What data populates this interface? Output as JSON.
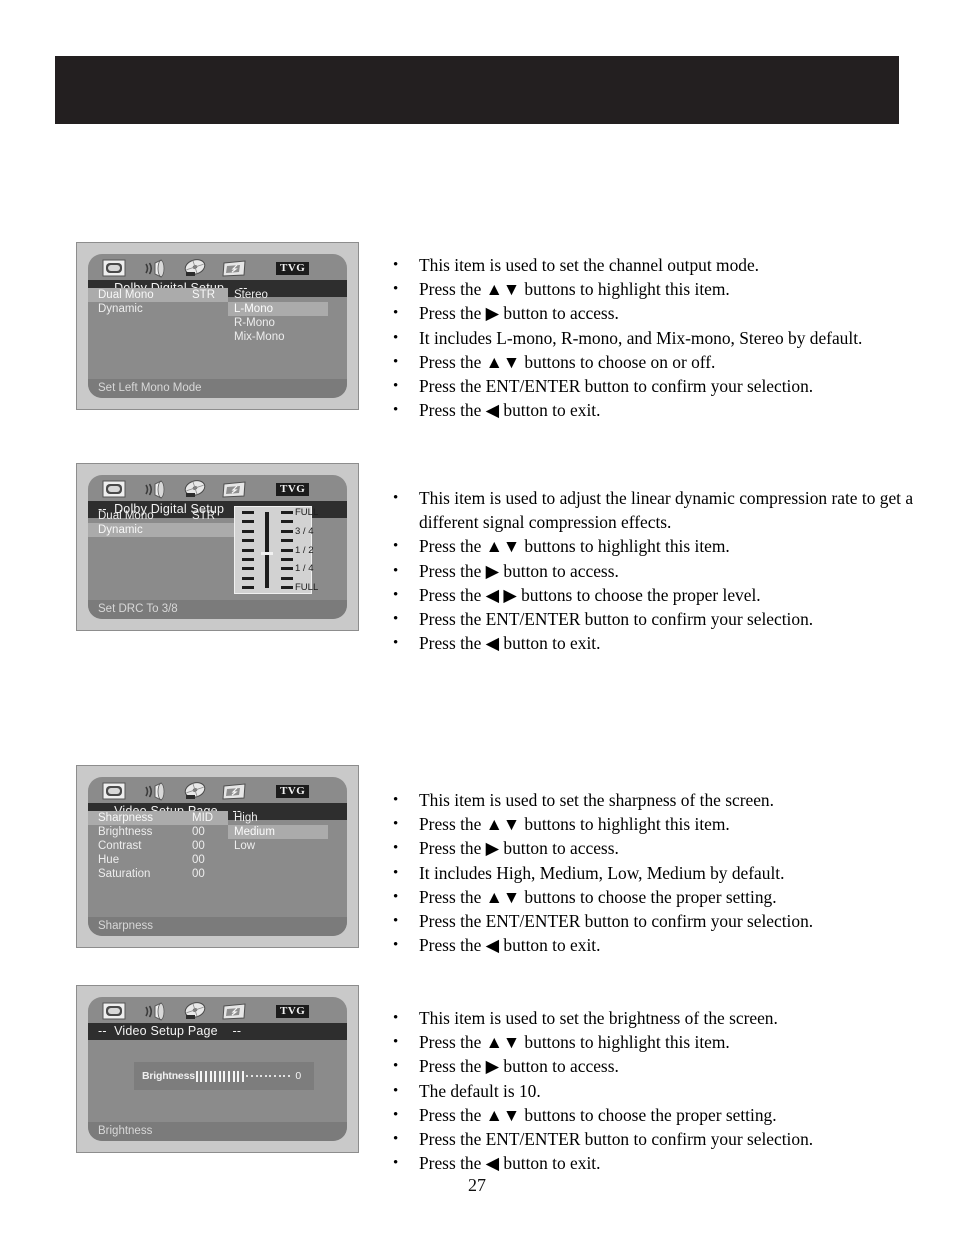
{
  "page": {
    "number": "27",
    "header_band_color": "#231f20"
  },
  "icons": [
    "tv-picture-icon",
    "speaker-audio-icon",
    "disc-setup-icon",
    "display-preference-icon"
  ],
  "tvg_badge": "TVG",
  "figures": [
    {
      "id": "dual-mono",
      "title": "--  Dolby Digital Setup    --",
      "rows": [
        {
          "label": "Dual Mono",
          "value": "STR",
          "selected": true
        },
        {
          "label": "Dynamic",
          "value": "",
          "selected": false
        }
      ],
      "options": [
        "Stereo",
        "L-Mono",
        "R-Mono",
        "Mix-Mono"
      ],
      "selected_option": "L-Mono",
      "hint": "Set Left Mono Mode"
    },
    {
      "id": "dynamic-drc",
      "title": "--  Dolby Digital Setup    --",
      "rows": [
        {
          "label": "Dual Mono",
          "value": "STR",
          "selected": false
        },
        {
          "label": "Dynamic",
          "value": "",
          "selected": true
        }
      ],
      "options": [],
      "selected_option": "",
      "hint": "Set DRC To 3/8",
      "drc": {
        "labels": [
          "FULL",
          "3 / 4",
          "1 / 2",
          "1 / 4",
          "FULL"
        ],
        "tick_rows": 9,
        "knob_position": "3/8"
      }
    },
    {
      "id": "sharpness",
      "title": "--  Video Setup Page    --",
      "rows": [
        {
          "label": "Sharpness",
          "value": "MID",
          "selected": true
        },
        {
          "label": "Brightness",
          "value": "00",
          "selected": false
        },
        {
          "label": "Contrast",
          "value": "00",
          "selected": false
        },
        {
          "label": "Hue",
          "value": "00",
          "selected": false
        },
        {
          "label": "Saturation",
          "value": "00",
          "selected": false
        }
      ],
      "options": [
        "High",
        "Medium",
        "Low"
      ],
      "selected_option": "Medium",
      "hint": "Sharpness"
    },
    {
      "id": "brightness",
      "title": "--  Video Setup Page    --",
      "rows": [],
      "options": [],
      "selected_option": "",
      "hint": "Brightness",
      "brightness_bar": {
        "label": "Brightness",
        "filled": 11,
        "empty": 10,
        "value": "0"
      }
    }
  ],
  "notes": [
    {
      "id": "dual-mono-notes",
      "items": [
        "This item is used to set the channel output mode.",
        "Press the ▲▼ buttons to highlight this item.",
        "Press the ▶ button to access.",
        "It includes L-mono, R-mono, and Mix-mono, Stereo by default.",
        "Press the ▲▼ buttons to choose on or off.",
        "Press the ENT/ENTER button to confirm your selection.",
        "Press the ◀ button to exit."
      ]
    },
    {
      "id": "dynamic-notes",
      "items": [
        "This item is used to adjust the linear dynamic compression rate to get a different signal compression effects.",
        "Press the ▲▼ buttons to highlight this item.",
        "Press the ▶ button to access.",
        "Press the ◀ ▶    buttons to choose the proper level.",
        "Press the ENT/ENTER button to confirm your selection.",
        "Press the ◀ button to exit."
      ]
    },
    {
      "id": "sharpness-notes",
      "items": [
        "This item is used to set the sharpness of the screen.",
        "Press the ▲▼ buttons to highlight this item.",
        "Press the ▶ button to access.",
        "It includes High, Medium, Low, Medium by default.",
        "Press the ▲▼ buttons to choose the proper setting.",
        "Press the ENT/ENTER button to confirm your selection.",
        "Press the ◀ button to exit."
      ]
    },
    {
      "id": "brightness-notes",
      "items": [
        "This item is used to set the brightness of the screen.",
        "Press the ▲▼ buttons to highlight this item.",
        "Press the ▶ button to access.",
        "The default is 10.",
        "Press the ▲▼ buttons to choose the proper setting.",
        "Press the ENT/ENTER button to confirm your selection.",
        "Press the ◀ button to exit."
      ]
    }
  ]
}
